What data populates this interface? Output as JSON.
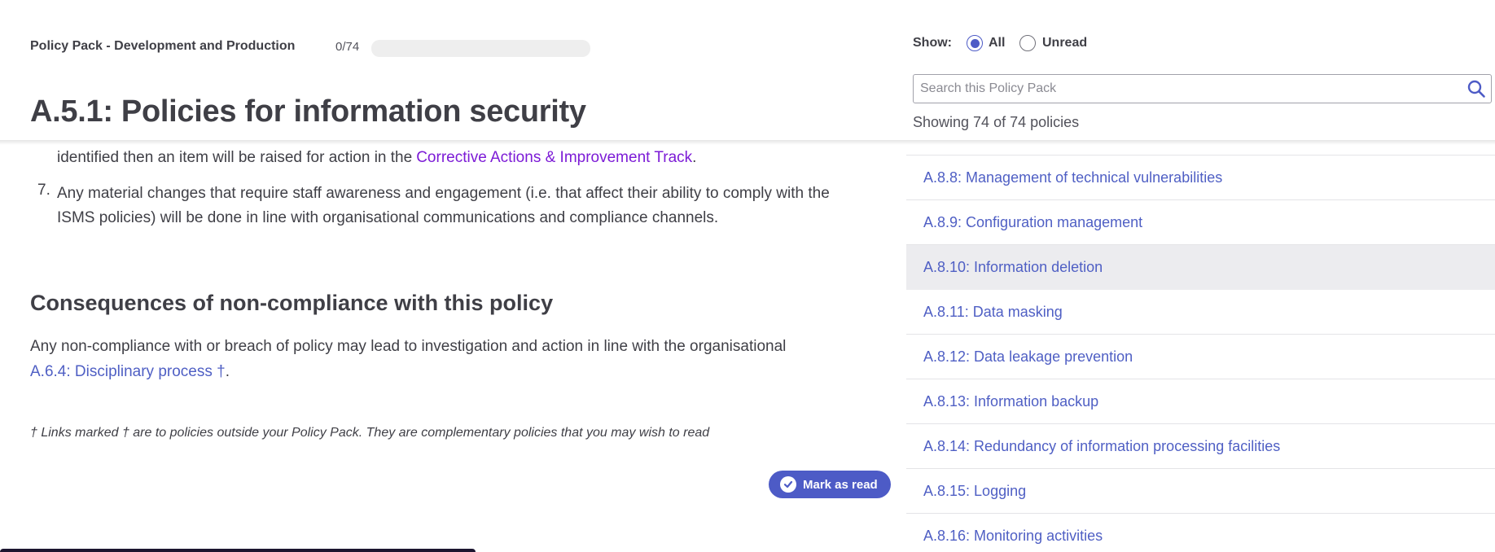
{
  "header": {
    "pack_title": "Policy Pack - Development and Production",
    "progress_text": "0/74",
    "progress_fraction": 0,
    "page_title": "A.5.1: Policies for information security"
  },
  "content": {
    "partial_line": "identified then an item will be raised for action in the Corrective Actions & Improvement Track.",
    "item6_cont_text": "identified then an item will be raised for action in the",
    "item6_link": "Corrective Actions & Improvement Track",
    "item6_end": ".",
    "item7_number": "7.",
    "item7_text": "Any material changes that require staff awareness and engagement (i.e. that affect their ability to comply with the ISMS policies) will be done in line with organisational communications and compliance channels.",
    "section_heading": "Consequences of non-compliance with this policy",
    "para_text": "Any non-compliance with or breach of policy may lead to investigation and action in line with the organisational",
    "para_link": "A.6.4: Disciplinary process †",
    "para_end": ".",
    "footnote": "† Links marked † are to policies outside your Policy Pack. They are complementary policies that you may wish to read",
    "mark_button": "Mark as read"
  },
  "sidebar": {
    "show_label": "Show:",
    "filter_all": "All",
    "filter_unread": "Unread",
    "search_placeholder": "Search this Policy Pack",
    "showing_text": "Showing 74 of 74 policies",
    "items": [
      {
        "label": "A.8.8: Management of technical vulnerabilities"
      },
      {
        "label": "A.8.9: Configuration management"
      },
      {
        "label": "A.8.10: Information deletion"
      },
      {
        "label": "A.8.11: Data masking"
      },
      {
        "label": "A.8.12: Data leakage prevention"
      },
      {
        "label": "A.8.13: Information backup"
      },
      {
        "label": "A.8.14: Redundancy of information processing facilities"
      },
      {
        "label": "A.8.15: Logging"
      },
      {
        "label": "A.8.16: Monitoring activities"
      }
    ],
    "active_item": "A.8.10: Information deletion"
  },
  "colors": {
    "accent": "#4d5bc6",
    "link": "#4f5fc4",
    "purple_link": "#7c1bd6",
    "text": "#3f3f46"
  }
}
